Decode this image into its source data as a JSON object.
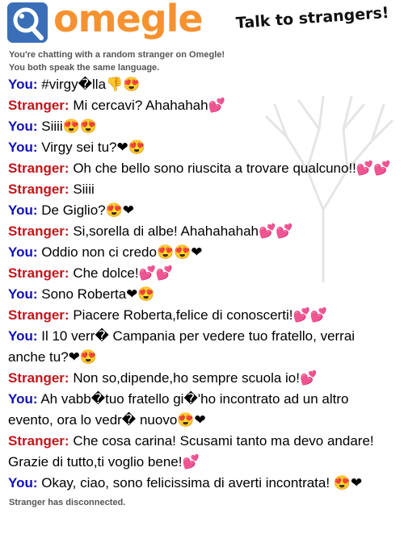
{
  "header": {
    "logo_text": "omegle",
    "tagline": "Talk to strangers!"
  },
  "status": {
    "line1": "You're chatting with a random stranger on Omegle!",
    "line2": "You both speak the same language."
  },
  "messages": [
    {
      "who": "You:",
      "role": "you",
      "text": "#virgy�lla👎😍"
    },
    {
      "who": "Stranger:",
      "role": "stranger",
      "text": "Mi cercavi? Ahahahah💕"
    },
    {
      "who": "You:",
      "role": "you",
      "text": "Siiii😍😍"
    },
    {
      "who": "You:",
      "role": "you",
      "text": "Virgy sei tu?❤😍"
    },
    {
      "who": "Stranger:",
      "role": "stranger",
      "text": "Oh che bello sono riuscita a trovare qualcuno!!💕💕"
    },
    {
      "who": "Stranger:",
      "role": "stranger",
      "text": "Siiii"
    },
    {
      "who": "You:",
      "role": "you",
      "text": "De Giglio?😍❤"
    },
    {
      "who": "Stranger:",
      "role": "stranger",
      "text": "Si,sorella di albe! Ahahahahah💕💕"
    },
    {
      "who": "You:",
      "role": "you",
      "text": "Oddio non ci credo😍😍❤"
    },
    {
      "who": "Stranger:",
      "role": "stranger",
      "text": "Che dolce!💕💕"
    },
    {
      "who": "You:",
      "role": "you",
      "text": "Sono Roberta❤😍"
    },
    {
      "who": "Stranger:",
      "role": "stranger",
      "text": "Piacere Roberta,felice di conoscerti!💕💕"
    },
    {
      "who": "You:",
      "role": "you",
      "text": "Il 10 verr� Campania per vedere tuo fratello, verrai anche tu?❤😍"
    },
    {
      "who": "Stranger:",
      "role": "stranger",
      "text": "Non so,dipende,ho sempre scuola io!💕"
    },
    {
      "who": "You:",
      "role": "you",
      "text": "Ah vabb�tuo fratello gi�'ho incontrato ad un altro evento, ora lo vedr� nuovo😍❤"
    },
    {
      "who": "Stranger:",
      "role": "stranger",
      "text": "Che cosa carina! Scusami tanto ma devo andare! Grazie di tutto,ti voglio bene!💕"
    },
    {
      "who": "You:",
      "role": "you",
      "text": "Okay, ciao, sono felicissima di averti incontrata! 😍❤"
    }
  ],
  "end_notice": "Stranger has disconnected.",
  "colors": {
    "you": "#1010b8",
    "stranger": "#c4141b",
    "logo_orange": "#f6912f",
    "logo_blue": "#3a6fb8"
  },
  "icons": {
    "logo": "omegle-logo-icon",
    "watermark": "tree-watermark"
  }
}
